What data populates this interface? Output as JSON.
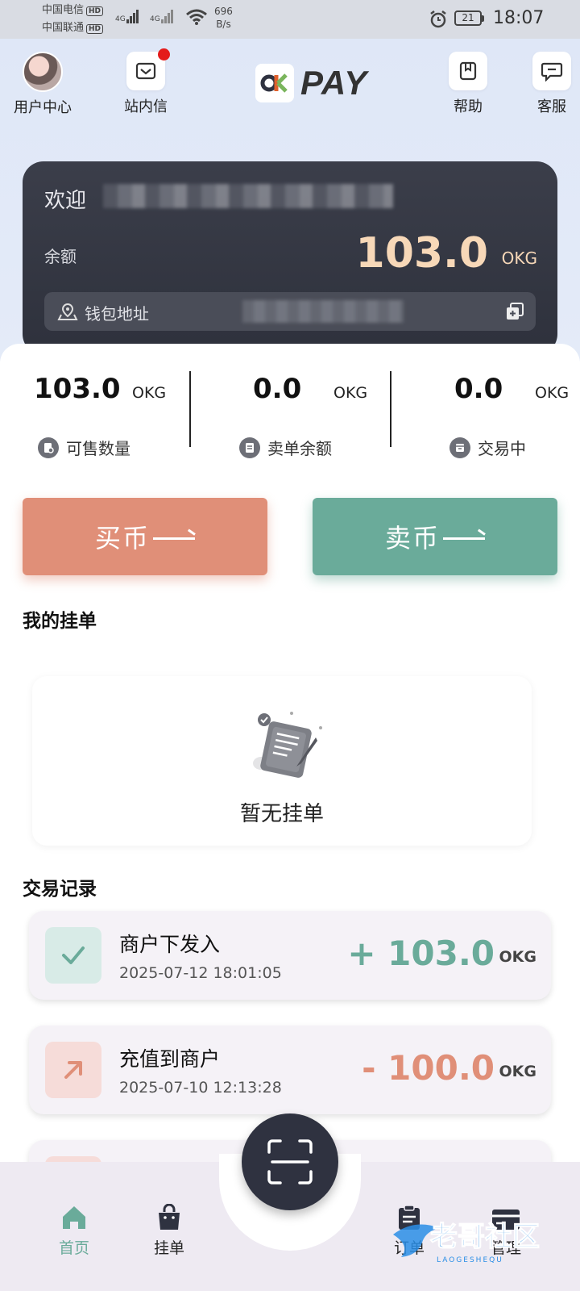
{
  "status_bar": {
    "carrier1": "中国电信",
    "carrier2": "中国联通",
    "hd": "HD",
    "net_type": "4G",
    "speed_value": "696",
    "speed_unit": "B/s",
    "battery": "21",
    "time": "18:07"
  },
  "header": {
    "user_center": "用户中心",
    "inbox": "站内信",
    "logo_text": "PAY",
    "help": "帮助",
    "service": "客服"
  },
  "wallet": {
    "welcome": "欢迎",
    "balance_label": "余额",
    "balance_value": "103.0",
    "balance_unit": "OKG",
    "address_label": "钱包地址"
  },
  "stats": [
    {
      "value": "103.0",
      "unit": "OKG",
      "label": "可售数量"
    },
    {
      "value": "0.0",
      "unit": "OKG",
      "label": "卖单余额"
    },
    {
      "value": "0.0",
      "unit": "OKG",
      "label": "交易中"
    }
  ],
  "actions": {
    "buy": "买币",
    "sell": "卖币"
  },
  "my_orders": {
    "title": "我的挂单",
    "empty_text": "暂无挂单"
  },
  "records": {
    "title": "交易记录",
    "items": [
      {
        "title": "商户下发入",
        "date": "2025-07-12 18:01:05",
        "amount": "+ 103.0",
        "unit": "OKG",
        "color": "#6aab9a",
        "icon": "check-icon"
      },
      {
        "title": "充值到商户",
        "date": "2025-07-10 12:13:28",
        "amount": "- 100.0",
        "unit": "OKG",
        "color": "#e08f78",
        "icon": "arrow-up-right-icon"
      }
    ]
  },
  "nav": {
    "home": "首页",
    "orders_list": "挂单",
    "orders": "订单",
    "manage": "管理",
    "active_color": "#6aab9a"
  },
  "watermark": {
    "text": "老哥社区",
    "sub": "LAOGESHEQU"
  }
}
